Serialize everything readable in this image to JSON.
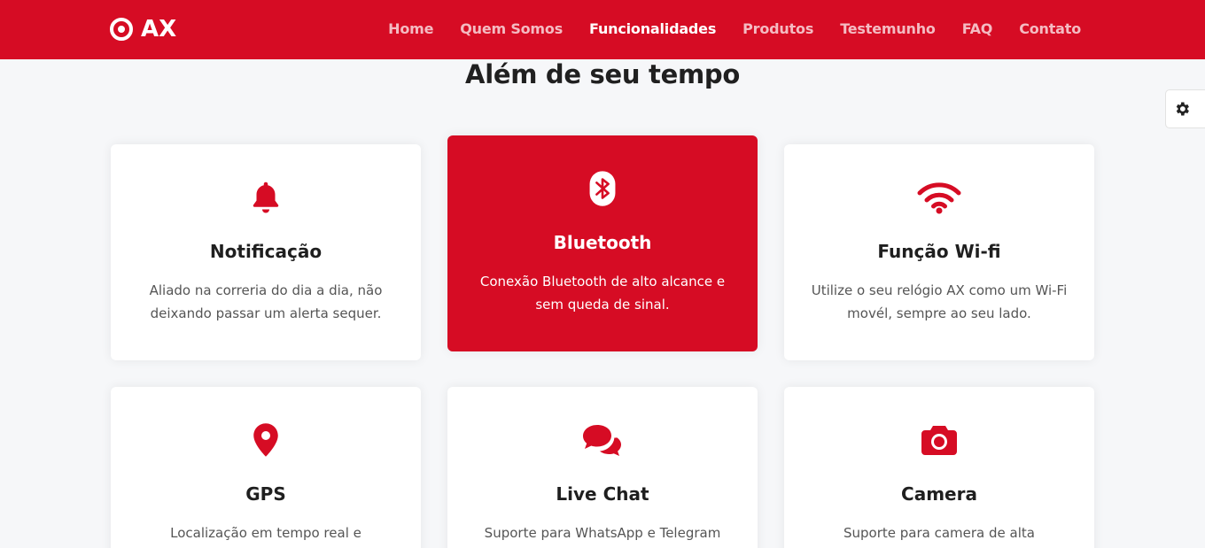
{
  "brand": {
    "name": "AX",
    "icon": "target-logo-icon"
  },
  "nav": {
    "items": [
      {
        "label": "Home"
      },
      {
        "label": "Quem Somos"
      },
      {
        "label": "Funcionalidades",
        "active": true
      },
      {
        "label": "Produtos"
      },
      {
        "label": "Testemunho"
      },
      {
        "label": "FAQ"
      },
      {
        "label": "Contato"
      }
    ]
  },
  "section": {
    "title": "Além de seu tempo"
  },
  "settings": {
    "icon": "gear-icon"
  },
  "features": [
    {
      "icon": "bell-icon",
      "title": "Notificação",
      "text": "Aliado na correria do dia a dia, não deixando passar um alerta sequer."
    },
    {
      "icon": "bluetooth-icon",
      "title": "Bluetooth",
      "text": "Conexão Bluetooth de alto alcance e sem queda de sinal.",
      "active": true
    },
    {
      "icon": "wifi-icon",
      "title": "Função Wi-fi",
      "text": "Utilize o seu relógio AX como um Wi-Fi movél, sempre ao seu lado."
    },
    {
      "icon": "map-pin-icon",
      "title": "GPS",
      "text": "Localização em tempo real e"
    },
    {
      "icon": "chat-icon",
      "title": "Live Chat",
      "text": "Suporte para WhatsApp e Telegram"
    },
    {
      "icon": "camera-icon",
      "title": "Camera",
      "text": "Suporte para camera de alta"
    }
  ],
  "colors": {
    "brand_red": "#d60c24",
    "background": "#f6f7f9",
    "card": "#ffffff"
  }
}
